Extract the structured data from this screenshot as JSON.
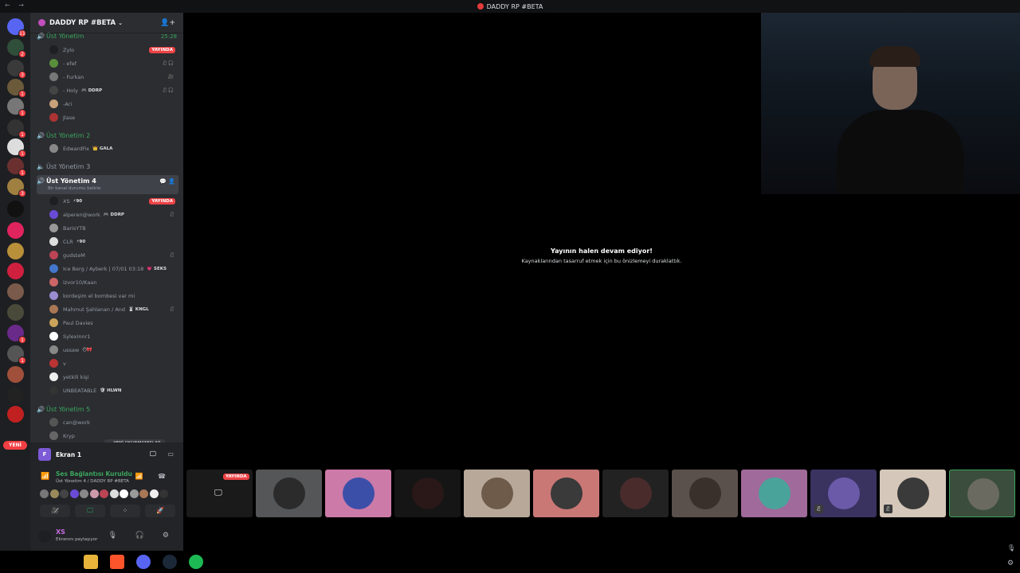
{
  "window": {
    "title": "DADDY RP #BETA",
    "nav": "← →"
  },
  "rail": {
    "badges": [
      "11",
      "2",
      "3",
      "1",
      "1",
      "1",
      "1",
      "1",
      "3",
      "1",
      "1",
      "2"
    ],
    "new_label": "YENİ",
    "colors": {
      "rail": "#1e1f22",
      "badge": "#f23f43"
    }
  },
  "server": {
    "name": "DADDY RP #BETA",
    "chevron": "⌄",
    "invite_icon": "person-add-icon"
  },
  "channels": {
    "c1": {
      "name": "Üst Yönetim",
      "time": "25:28"
    },
    "c2": {
      "name": "Üst Yönetim 2"
    },
    "c3": {
      "name": "Üst Yönetim 3"
    },
    "c4": {
      "name": "Üst Yönetim 4",
      "status": "Bir kanal durumu belirle"
    },
    "c5": {
      "name": "Üst Yönetim 5"
    }
  },
  "users1": [
    {
      "name": "Zylo",
      "live": "YAYINDA",
      "color": "#1e1f22"
    },
    {
      "name": "- efef",
      "icon": "🎙̸ 🎧",
      "color": "#5a8f3b"
    },
    {
      "name": "- Furkan",
      "icon": "🎥",
      "color": "#777"
    },
    {
      "name": "- Holy",
      "tag": "🎮 DDRP",
      "icon": "🎙̸ 🎧",
      "color": "#444"
    },
    {
      "name": "-Ari",
      "color": "#c8a27a"
    },
    {
      "name": "Jlase",
      "color": "#a33"
    }
  ],
  "users2": [
    {
      "name": "EdwardFix",
      "tag": "👑 GALA",
      "color": "#888"
    }
  ],
  "users4": [
    {
      "name": "XS",
      "tag": "⚡90",
      "live": "YAYINDA",
      "color": "#1e1f22"
    },
    {
      "name": "alperen@work",
      "tag": "🎮 DDRP",
      "icon": "🎙̸",
      "color": "#6a4bd6"
    },
    {
      "name": "BarisYTB",
      "color": "#999"
    },
    {
      "name": "CLR",
      "tag": "⚡90",
      "color": "#ddd"
    },
    {
      "name": "gudsteM",
      "icon": "🎙̸",
      "color": "#b45"
    },
    {
      "name": "Ice Berg / Ayberk | 07/01 03:18",
      "tag": "💗 SEKS",
      "color": "#47c"
    },
    {
      "name": "izvor10/Kaan",
      "color": "#c66"
    },
    {
      "name": "kordeşim el bombesi var mi",
      "color": "#9b8bd0"
    },
    {
      "name": "Mahmut Şahlanan / And",
      "tag": "🐰 KNGL",
      "icon": "🎙̸",
      "color": "#a75"
    },
    {
      "name": "Paul Davies",
      "color": "#c9a45a"
    },
    {
      "name": "Sylexinnr1",
      "color": "#fff"
    },
    {
      "name": "ussaw",
      "tag": "😶🎀",
      "color": "#888"
    },
    {
      "name": "v",
      "color": "#b33"
    },
    {
      "name": "yetkili kişi",
      "color": "#eee"
    },
    {
      "name": "UNBEATABLE",
      "tag": "🛡 HLWN",
      "color": "#333"
    }
  ],
  "users5": [
    {
      "name": "can@work",
      "color": "#555"
    },
    {
      "name": "Kryp",
      "color": "#666"
    }
  ],
  "unread_label": "⌄ YENİ OKUNMAMIŞLAR",
  "panel": {
    "screen_title": "Ekran 1",
    "screen_icon_letter": "F",
    "screen_buttons": "🖵 ▭",
    "vc_status": "Ses Bağlantısı Kuruldu",
    "vc_channel": "Üst Yönetim 4 / DADDY RP #BETA",
    "vc_buttons": "📶 ☎",
    "actions": [
      "🎥̸",
      "🖵",
      "⁘",
      "🚀"
    ],
    "user": {
      "name": "XS",
      "status": "Ekranını paylaşıyor"
    },
    "user_controls": "🎙 🎧 ⚙"
  },
  "stream_paused": {
    "title": "Yayının halen devam ediyor!",
    "subtitle": "Kaynaklarından tasarruf etmek için bu önizlemeyi duraklattık."
  },
  "tiles": [
    {
      "bg": "#1a1a1a",
      "live": "YAYINDA",
      "monitor": "🖵"
    },
    {
      "bg": "#555658",
      "round": "#2b2b2b"
    },
    {
      "bg": "#cc7aa8",
      "round": "#3c4fa8"
    },
    {
      "bg": "#151515",
      "round": "#2a1818"
    },
    {
      "bg": "#b7a899",
      "round": "#6e5b4a"
    },
    {
      "bg": "#c97876",
      "round": "#3a3a3a"
    },
    {
      "bg": "#222222",
      "round": "#4a2b2b"
    },
    {
      "bg": "#5a504c",
      "round": "#3a302b"
    },
    {
      "bg": "#a06a9a",
      "round": "#4aa39a"
    },
    {
      "bg": "#3a3360",
      "round": "#6a5aa8",
      "mute": "🎙̸"
    },
    {
      "bg": "#d5c7b9",
      "round": "#3a3a3a",
      "mute": "🎙̸"
    },
    {
      "bg": "#3b4d3c",
      "round": "#6a6a60"
    }
  ],
  "tray": {
    "mic": "🎙",
    "gear": "⚙"
  },
  "taskbar_apps": [
    {
      "name": "file-explorer",
      "color": "#e8b43a"
    },
    {
      "name": "brave",
      "color": "#fb542b"
    },
    {
      "name": "discord",
      "color": "#5865f2"
    },
    {
      "name": "steam",
      "color": "#1b2838"
    },
    {
      "name": "spotify",
      "color": "#1db954"
    }
  ]
}
